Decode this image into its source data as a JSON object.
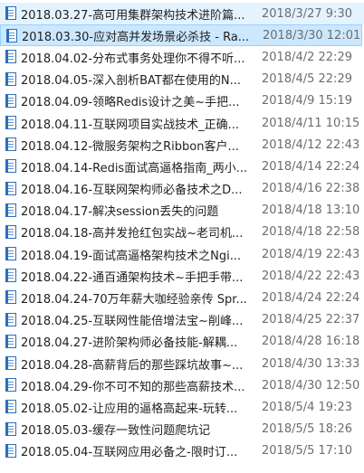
{
  "files": [
    {
      "name": "2018.03.27-高可用集群架构技术进阶篇...",
      "date": "2018/3/27 9:30"
    },
    {
      "name": "2018.03.30-应对高并发场景必杀技 - Ra...",
      "date": "2018/3/30 12:01"
    },
    {
      "name": "2018.04.02-分布式事务处理你不得不听...",
      "date": "2018/4/2 22:29"
    },
    {
      "name": "2018.04.05-深入剖析BAT都在使用的N...",
      "date": "2018/4/5 22:29"
    },
    {
      "name": "2018.04.09-领略Redis设计之美~手把...",
      "date": "2018/4/9 15:19"
    },
    {
      "name": "2018.04.11-互联网项目实战技术_正确...",
      "date": "2018/4/11 10:15"
    },
    {
      "name": "2018.04.12-微服务架构之Ribbon客户...",
      "date": "2018/4/12 22:43"
    },
    {
      "name": "2018.04.14-Redis面试高逼格指南_两小...",
      "date": "2018/4/14 22:24"
    },
    {
      "name": "2018.04.16-互联网架构师必备技术之D...",
      "date": "2018/4/16 22:38"
    },
    {
      "name": "2018.04.17-解决session丢失的问题",
      "date": "2018/4/18 13:10"
    },
    {
      "name": "2018.04.18-高并发抢红包实战~老司机...",
      "date": "2018/4/18 22:58"
    },
    {
      "name": "2018.04.19-面试高逼格架构技术之Ngi...",
      "date": "2018/4/19 22:43"
    },
    {
      "name": "2018.04.22-通百通架构技术~手把手带...",
      "date": "2018/4/22 22:43"
    },
    {
      "name": "2018.04.24-70万年薪大咖经验亲传 Spr...",
      "date": "2018/4/24 22:24"
    },
    {
      "name": "2018.04.25-互联网性能倍增法宝~削峰...",
      "date": "2018/4/25 22:37"
    },
    {
      "name": "2018.04.27-进阶架构师必备技能-解耦...",
      "date": "2018/4/28 16:18"
    },
    {
      "name": "2018.04.28-高薪背后的那些踩坑故事~...",
      "date": "2018/4/30 13:33"
    },
    {
      "name": "2018.04.29-你不可不知的那些高薪技术...",
      "date": "2018/4/30 12:50"
    },
    {
      "name": "2018.05.02-让应用的逼格高起来-玩转...",
      "date": "2018/5/4 19:23"
    },
    {
      "name": "2018.05.03-缓存一致性问题爬坑记",
      "date": "2018/5/5 18:26"
    },
    {
      "name": "2018.05.04-互联网应用必备之-限时订...",
      "date": "2018/5/5 17:10"
    }
  ],
  "selected_index": 1,
  "hover_index": 0,
  "icon": "text-document-icon"
}
